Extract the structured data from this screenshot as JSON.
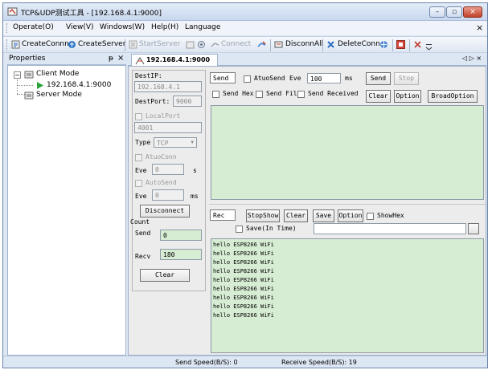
{
  "window": {
    "title": "TCP&UDP测试工具 - [192.168.4.1:9000]"
  },
  "menu": [
    "Operate(O)",
    "View(V)",
    "Windows(W)",
    "Help(H)",
    "Language"
  ],
  "menu_close": "×",
  "toolbar": {
    "create_conn": "CreateConnn",
    "create_server": "CreateServer",
    "start_server": "StartServer",
    "connect": "Connect",
    "disconn_all": "DisconnAll",
    "delete_conn": "DeleteConn"
  },
  "properties": {
    "title": "Properties",
    "pin": "ᵽ",
    "close": "×",
    "tree": {
      "client_mode": "Client Mode",
      "connection": "192.168.4.1:9000",
      "server_mode": "Server Mode"
    }
  },
  "doc_tab": {
    "label": "192.168.4.1:9000",
    "nav": "◁ ▷ ×"
  },
  "conn": {
    "dest_ip_label": "DestIP:",
    "dest_ip_value": "192.168.4.1",
    "dest_port_label": "DestPort:",
    "dest_port_value": "9000",
    "local_port_label": "LocalPort",
    "local_port_value": "4001",
    "type_label": "Type",
    "type_value": "TCP",
    "auto_conn_label": "AtuoConn",
    "eve_label": "Eve",
    "eve1_value": "0",
    "eve1_unit": "s",
    "auto_send_label": "AutoSend",
    "eve2_value": "0",
    "eve2_unit": "ms",
    "disconnect": "Disconnect",
    "count_label": "Count",
    "send_label": "Send",
    "send_count": "0",
    "recv_label": "Recv",
    "recv_count": "180",
    "clear": "Clear"
  },
  "send_panel": {
    "send_tab": "Send",
    "auto_send": "AtuoSend",
    "eve_label": "Eve",
    "eve_value": "100",
    "eve_unit": "ms",
    "send_btn": "Send",
    "stop_btn": "Stop",
    "send_hex": "Send Hex",
    "send_file": "Send File",
    "send_received": "Send Received",
    "clear_btn": "Clear",
    "option_btn": "Option",
    "broad_option_btn": "BroadOption"
  },
  "rec_panel": {
    "rec_tab": "Rec",
    "stop_show": "StopShow",
    "clear": "Clear",
    "save": "Save",
    "option": "Option",
    "show_hex": "ShowHex",
    "save_in_time": "Save(In Time)",
    "browse": "",
    "lines": [
      "hello ESP8266 WiFi",
      "hello ESP8266 WiFi",
      "hello ESP8266 WiFi",
      "hello ESP8266 WiFi",
      "hello ESP8266 WiFi",
      "hello ESP8266 WiFi",
      "hello ESP8266 WiFi",
      "hello ESP8266 WiFi",
      "hello ESP8266 WiFi"
    ]
  },
  "status": {
    "send_speed": "Send Speed(B/S): 0",
    "receive_speed": "Receive Speed(B/S): 19"
  },
  "colors": {
    "green_area": "#d7edd3",
    "frame": "#dde6f3",
    "play": "#27a43a"
  }
}
